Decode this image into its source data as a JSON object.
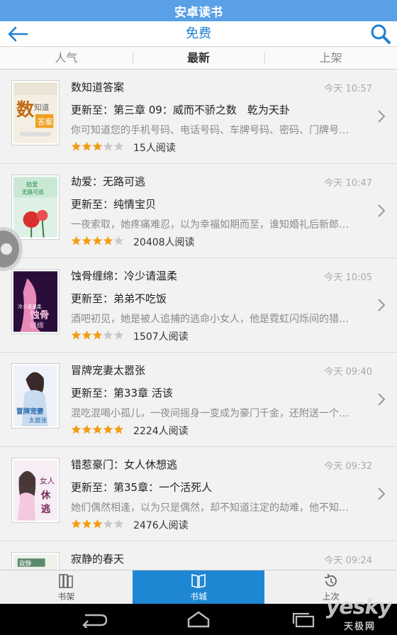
{
  "app": {
    "title": "安卓读书"
  },
  "header": {
    "page_title": "免费",
    "back_icon": "back-arrow-icon",
    "search_icon": "search-icon"
  },
  "tabs": [
    {
      "label": "人气",
      "active": false
    },
    {
      "label": "最新",
      "active": true
    },
    {
      "label": "上架",
      "active": false
    }
  ],
  "books": [
    {
      "title": "数知道答案",
      "time": "今天 10:57",
      "update": "更新至：第三章 09：威而不骄之数　乾为天卦",
      "desc": "你可知道您的手机号码、电话号码、车牌号码、密码、门牌号…",
      "rating": 3,
      "reads": "15人阅读"
    },
    {
      "title": "劫爱：无路可逃",
      "time": "今天 10:47",
      "update": "更新至：纯情宝贝",
      "desc": "一夜索取，她疼痛难忍，以为幸福如期而至，谁知婚礼后新郎…",
      "rating": 4,
      "reads": "20408人阅读"
    },
    {
      "title": "蚀骨缠绵：冷少请温柔",
      "time": "今天 10:05",
      "update": "更新至：弟弟不吃饭",
      "desc": "酒吧初见，她是被人追捕的逃命小女人，他是霓虹闪烁间的猎…",
      "rating": 3,
      "reads": "1507人阅读"
    },
    {
      "title": "冒牌宠妻太嚣张",
      "time": "今天 09:40",
      "update": "更新至：第33章 活该",
      "desc": "混吃混喝小孤儿，一夜间摇身一变成为豪门千金，还附送一个…",
      "rating": 5,
      "reads": "2224人阅读"
    },
    {
      "title": "错惹豪门：女人休想逃",
      "time": "今天 09:32",
      "update": "更新至：第35章：一个活死人",
      "desc": "她们偶然相逢，以为只是偶然，却不知道注定的劫难，他不知…",
      "rating": 3,
      "reads": "2476人阅读"
    },
    {
      "title": "寂静的春天",
      "time": "今天 09:24",
      "update": "",
      "desc": "",
      "rating": 0,
      "reads": ""
    }
  ],
  "bottom_nav": [
    {
      "label": "书架",
      "icon": "bookshelf-icon",
      "active": false
    },
    {
      "label": "书城",
      "icon": "bookstore-icon",
      "active": true
    },
    {
      "label": "上次",
      "icon": "history-icon",
      "active": false
    }
  ],
  "watermark": {
    "brand": "yesky",
    "sub": "天极网"
  },
  "colors": {
    "accent": "#1e87d4",
    "star": "#f39c12",
    "star_empty": "#c8c8c8",
    "title_bar": "#5aa0e6"
  }
}
